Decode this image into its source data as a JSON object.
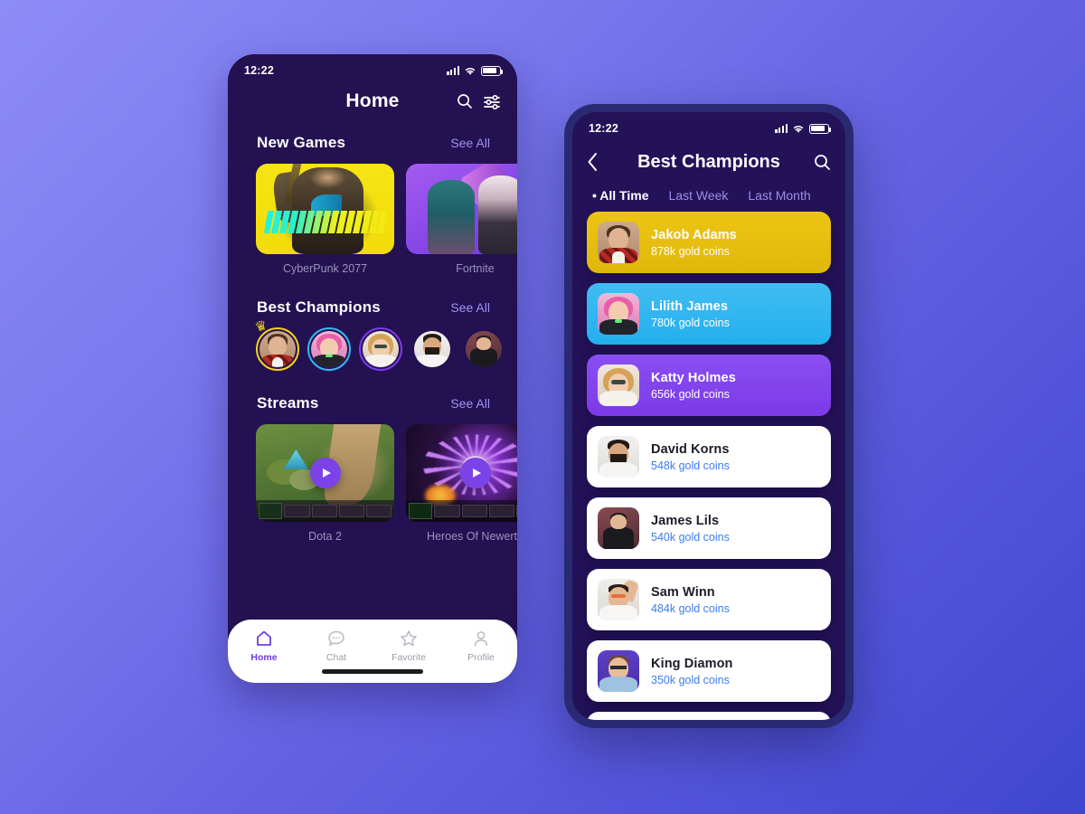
{
  "background": {
    "from": "#8d8cf7",
    "to": "#3f46cf"
  },
  "phone1": {
    "status": {
      "time": "12:22",
      "signal_icon": "signal-icon",
      "wifi_icon": "wifi-icon",
      "battery_icon": "battery-icon"
    },
    "header": {
      "title": "Home",
      "search_icon": "search-icon",
      "filter_icon": "filter-sliders-icon"
    },
    "sections": {
      "new_games": {
        "title": "New Games",
        "see_all": "See All",
        "cards": [
          {
            "label": "CyberPunk 2077",
            "art": "cyberpunk"
          },
          {
            "label": "Fortnite",
            "art": "fortnite"
          }
        ]
      },
      "best_champions": {
        "title": "Best Champions",
        "see_all": "See All",
        "avatars": [
          {
            "name": "Jakob Adams",
            "ring": "#f5d215",
            "crowned": true,
            "art": "jakob"
          },
          {
            "name": "Lilith James",
            "ring": "#35b8f0",
            "crowned": false,
            "art": "lilith"
          },
          {
            "name": "Katty Holmes",
            "ring": "#7c3ae8",
            "crowned": false,
            "art": "katty"
          },
          {
            "name": "David Korns",
            "ring": "#ffffff",
            "crowned": false,
            "art": "david"
          },
          {
            "name": "James Lils",
            "ring": "#ffffff",
            "crowned": false,
            "art": "james"
          },
          {
            "name": "Sam Winn",
            "ring": "#ffffff",
            "crowned": false,
            "art": "sam"
          }
        ]
      },
      "streams": {
        "title": "Streams",
        "see_all": "See All",
        "cards": [
          {
            "label": "Dota 2",
            "art": "dota",
            "play_icon": "play-icon"
          },
          {
            "label": "Heroes Of  Newerth",
            "art": "hon",
            "play_icon": "play-icon"
          }
        ]
      }
    },
    "tabbar": [
      {
        "label": "Home",
        "icon": "home-icon",
        "active": true
      },
      {
        "label": "Chat",
        "icon": "chat-bubble-icon",
        "active": false
      },
      {
        "label": "Favorite",
        "icon": "star-icon",
        "active": false
      },
      {
        "label": "Profile",
        "icon": "person-icon",
        "active": false
      }
    ]
  },
  "phone2": {
    "status": {
      "time": "12:22",
      "signal_icon": "signal-icon",
      "wifi_icon": "wifi-icon",
      "battery_icon": "battery-icon"
    },
    "header": {
      "title": "Best Champions",
      "back_icon": "chevron-left-icon",
      "search_icon": "search-icon"
    },
    "filters": [
      {
        "label": "All Time",
        "active": true
      },
      {
        "label": "Last Week",
        "active": false
      },
      {
        "label": "Last Month",
        "active": false
      }
    ],
    "ranking": [
      {
        "name": "Jakob Adams",
        "coins": "878k gold coins",
        "style": "gold",
        "art": "jakob"
      },
      {
        "name": "Lilith James",
        "coins": "780k gold coins",
        "style": "blue",
        "art": "lilith"
      },
      {
        "name": "Katty Holmes",
        "coins": "656k gold coins",
        "style": "purple",
        "art": "katty"
      },
      {
        "name": "David Korns",
        "coins": "548k gold coins",
        "style": "white",
        "art": "david"
      },
      {
        "name": "James Lils",
        "coins": "540k gold coins",
        "style": "white",
        "art": "james"
      },
      {
        "name": "Sam Winn",
        "coins": "484k gold coins",
        "style": "white",
        "art": "sam"
      },
      {
        "name": "King Diamon",
        "coins": "350k gold coins",
        "style": "white",
        "art": "king"
      },
      {
        "name": "",
        "coins": "",
        "style": "white",
        "art": "adolf"
      }
    ]
  }
}
